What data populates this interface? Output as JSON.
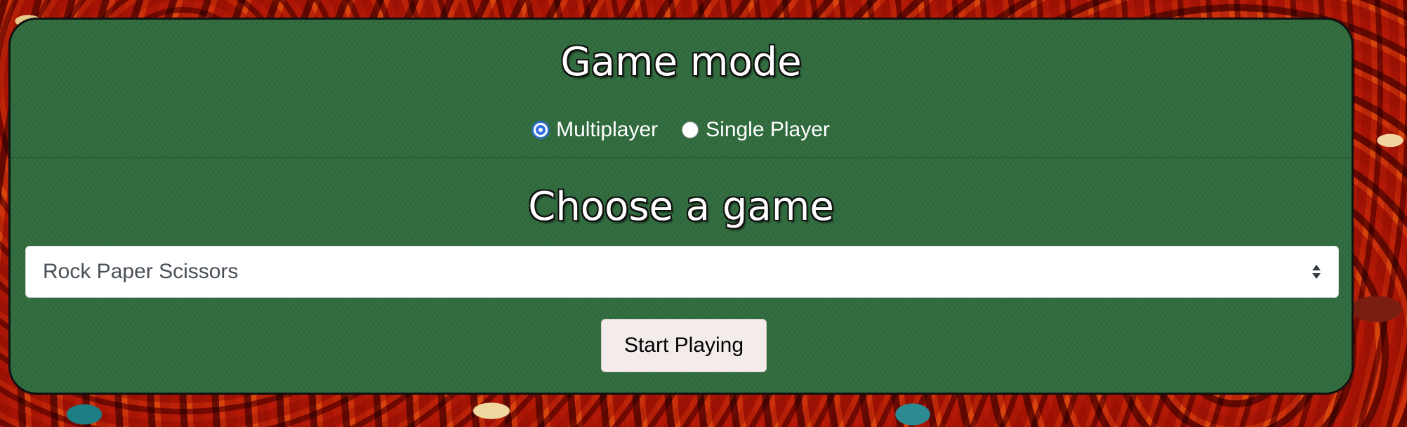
{
  "game_mode": {
    "title": "Game mode",
    "options": [
      {
        "label": "Multiplayer",
        "checked": true
      },
      {
        "label": "Single Player",
        "checked": false
      }
    ]
  },
  "game_select": {
    "title": "Choose a game",
    "selected": "Rock Paper Scissors"
  },
  "start_button": {
    "label": "Start Playing"
  },
  "colors": {
    "panel_green": "#2e6b3c",
    "radio_accent": "#2f6fe0",
    "button_bg": "#f4ebeb"
  },
  "icons": {
    "select_arrows": "sort-arrows-icon"
  }
}
